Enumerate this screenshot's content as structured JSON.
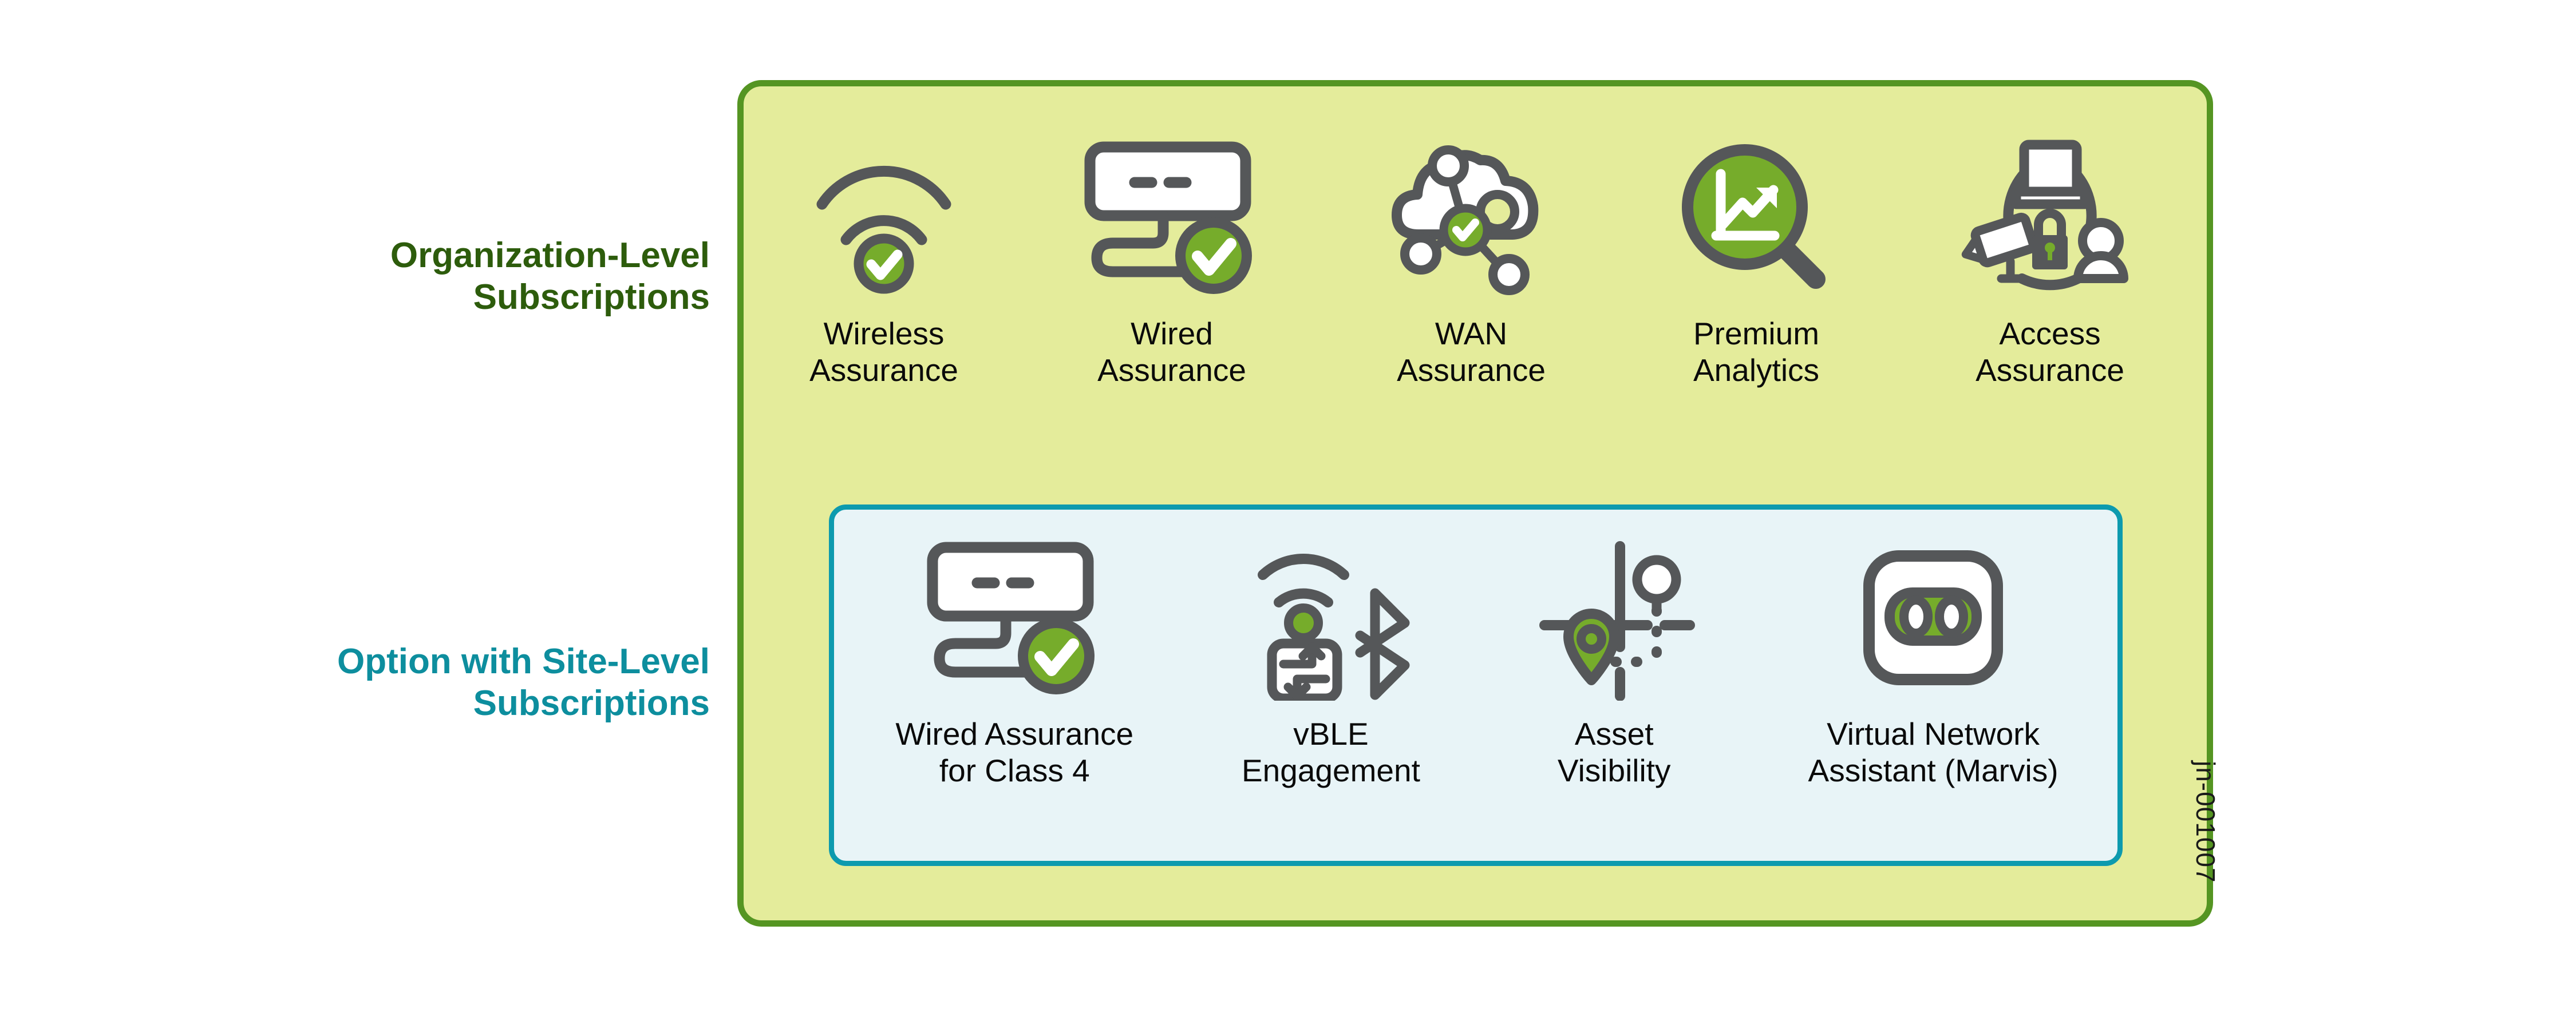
{
  "colors": {
    "panel_fill": "#e4ec9b",
    "panel_border": "#559522",
    "inner_fill": "#e8f4f7",
    "inner_border": "#0d9aae",
    "org_label": "#2d5c0c",
    "site_label": "#0d8e9e",
    "icon_stroke": "#555759",
    "accent_green": "#76ac2b",
    "icon_white": "#ffffff"
  },
  "labels": {
    "organization": {
      "line1": "Organization-Level",
      "line2": "Subscriptions"
    },
    "site": {
      "line1": "Option with Site-Level",
      "line2": "Subscriptions"
    }
  },
  "organization_subscriptions": [
    {
      "icon": "wireless-assurance-icon",
      "line1": "Wireless",
      "line2": "Assurance"
    },
    {
      "icon": "wired-assurance-icon",
      "line1": "Wired",
      "line2": "Assurance"
    },
    {
      "icon": "wan-assurance-icon",
      "line1": "WAN",
      "line2": "Assurance"
    },
    {
      "icon": "premium-analytics-icon",
      "line1": "Premium",
      "line2": "Analytics"
    },
    {
      "icon": "access-assurance-icon",
      "line1": "Access",
      "line2": "Assurance"
    }
  ],
  "site_subscriptions": [
    {
      "icon": "wired-assurance-class4-icon",
      "line1": "Wired Assurance",
      "line2": "for Class 4"
    },
    {
      "icon": "vble-engagement-icon",
      "line1": "vBLE",
      "line2": "Engagement"
    },
    {
      "icon": "asset-visibility-icon",
      "line1": "Asset",
      "line2": "Visibility"
    },
    {
      "icon": "virtual-network-assistant-icon",
      "line1": "Virtual Network",
      "line2": "Assistant (Marvis)"
    }
  ],
  "caption": "jn-001007"
}
